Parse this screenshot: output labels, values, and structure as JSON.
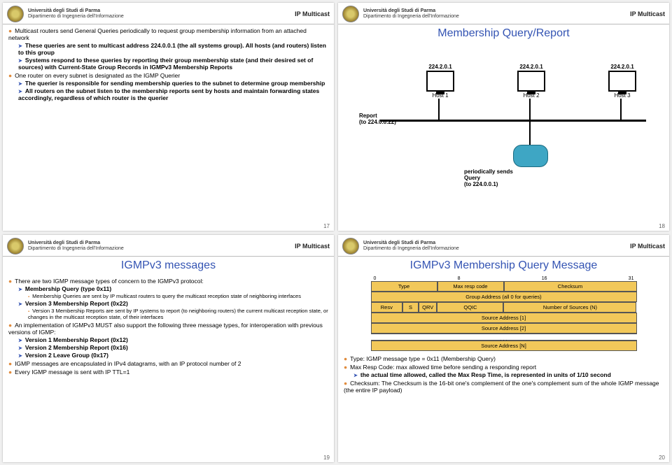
{
  "header": {
    "uni1": "Università degli Studi di Parma",
    "uni2": "Dipartimento di Ingegneria dell'Informazione",
    "course": "IP Multicast"
  },
  "s1": {
    "b1": "Multicast routers send General Queries periodically to request group membership information from an attached network",
    "b1a": "These queries are sent to multicast address 224.0.0.1 (the all systems group). All hosts (and routers) listen to this group",
    "b1b": "Systems respond to these queries by reporting their group membership state (and their desired set of sources) with Current-State Group Records in IGMPv3 Membership Reports",
    "b2": "One router on every subnet is designated as the IGMP Querier",
    "b2a": "The querier is responsible for sending membership queries to the subnet to determine group membership",
    "b2b": "All routers on the subnet listen to the membership reports sent by hosts and maintain forwarding states accordingly, regardless of which router is the querier",
    "page": "17"
  },
  "s2": {
    "title": "Membership Query/Report",
    "ip": "224.2.0.1",
    "h1": "Host 1",
    "h2": "Host 2",
    "h3": "Host 3",
    "report": "Report",
    "report2": "(to 224.0.0.22)",
    "q1": "periodically sends",
    "q2": "Query",
    "q3": "(to 224.0.0.1)",
    "page": "18"
  },
  "s3": {
    "title": "IGMPv3 messages",
    "b1": "There are two IGMP message types of concern to the IGMPv3 protocol:",
    "b1a": "Membership Query (type 0x11)",
    "b1a1": "Membership Queries are sent by IP multicast routers to query the multicast reception state of neighboring interfaces",
    "b1b": "Version 3 Membership Report (0x22)",
    "b1b1": "Version 3 Membership Reports are sent by IP systems to report (to neighboring routers) the current multicast reception state, or changes in the multicast reception state, of their interfaces",
    "b2": "An implementation of IGMPv3 MUST also support the following three message types, for interoperation with previous versions of IGMP:",
    "b2a": "Version 1 Membership Report (0x12)",
    "b2b": "Version 2 Membership Report (0x16)",
    "b2c": "Version 2 Leave Group (0x17)",
    "b3": "IGMP messages are encapsulated in IPv4 datagrams, with an IP protocol number of 2",
    "b4": "Every IGMP message is sent with IP TTL=1",
    "page": "19"
  },
  "s4": {
    "title": "IGMPv3 Membership Query Message",
    "bits": [
      "0",
      "8",
      "16",
      "31"
    ],
    "r1": [
      "Type",
      "Max resp code",
      "Checksum"
    ],
    "r2": "Group Address (all 0 for queries)",
    "r3": [
      "Resv",
      "S",
      "QRV",
      "QQIC",
      "Number of Sources (N)"
    ],
    "r4": "Source Address [1]",
    "r5": "Source Address [2]",
    "r6": ". . .",
    "r7": "Source Address [N]",
    "b1": "Type: IGMP message type = 0x11 (Membership Query)",
    "b2": "Max Resp Code: max allowed time before sending a responding report",
    "b2a": "the actual time allowed, called the Max Resp Time, is represented in units of 1/10 second",
    "b3": "Checksum: The Checksum is the 16-bit one's complement of the one's complement sum of the whole IGMP message (the entire IP payload)",
    "page": "20"
  }
}
